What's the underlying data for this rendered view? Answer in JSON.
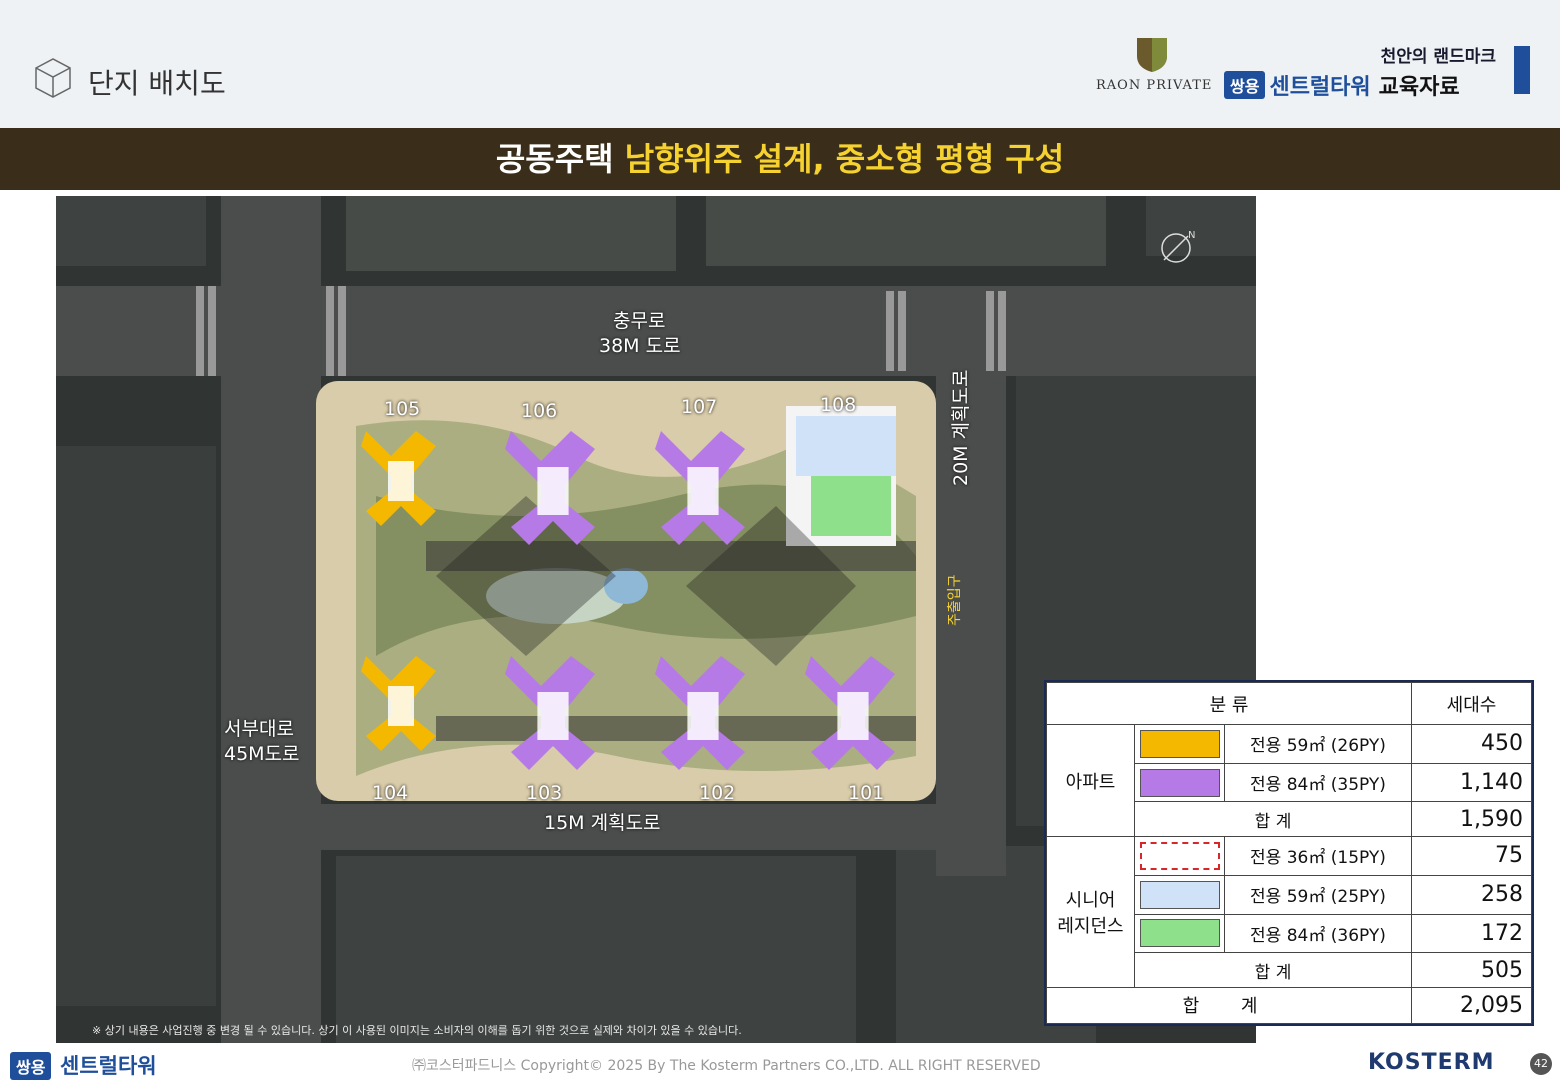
{
  "header": {
    "title": "단지 배치도",
    "raon_text": "RAON PRIVATE",
    "tagline": "천안의 랜드마크",
    "brand_badge": "쌍용",
    "brand_name": "센트럴타워",
    "edu_label": "교육자료"
  },
  "banner": {
    "part1": "공동주택 ",
    "part2": "남향위주 설계, 중소형 평형 구성"
  },
  "plan": {
    "road_north": "충무로",
    "road_north_width": "38M 도로",
    "road_west": "서부대로",
    "road_west_width": "45M도로",
    "road_south": "15M 계획도로",
    "road_east": "20M 계획도로",
    "gate_east": "주출입구",
    "buildings": {
      "b101": "101",
      "b102": "102",
      "b103": "103",
      "b104": "104",
      "b105": "105",
      "b106": "106",
      "b107": "107",
      "b108": "108"
    },
    "disclaimer": "※ 상기 내용은 사업진행 중 변경 될 수 있습니다. 상기 이 사용된 이미지는 소비자의 이해를 돕기 위한 것으로 실제와 차이가 있을 수 있습니다."
  },
  "table": {
    "header_category": "분 류",
    "header_units": "세대수",
    "apt_label": "아파트",
    "senior_label_1": "시니어",
    "senior_label_2": "레지던스",
    "rows": [
      {
        "desc": "전용  59㎡ (26PY)",
        "units": "450"
      },
      {
        "desc": "전용  84㎡ (35PY)",
        "units": "1,140"
      },
      {
        "desc": "합  계",
        "units": "1,590"
      },
      {
        "desc": "전용  36㎡ (15PY)",
        "units": "75"
      },
      {
        "desc": "전용  59㎡ (25PY)",
        "units": "258"
      },
      {
        "desc": "전용  84㎡ (36PY)",
        "units": "172"
      },
      {
        "desc": "합  계",
        "units": "505"
      }
    ],
    "grand_total_label": "합 계",
    "grand_total_units": "2,095"
  },
  "colors": {
    "apt59": "#f5b800",
    "apt84": "#b57ae6",
    "sr59": "#cfe2f7",
    "sr84": "#8ee08a",
    "brand_blue": "#1f4f9b",
    "banner_bg": "#3a2e1b",
    "banner_accent": "#f5d230"
  },
  "footer": {
    "badge": "쌍용",
    "brand": "센트럴타워",
    "copyright": "㈜코스터파드니스 Copyright© 2025 By The Kosterm Partners CO.,LTD. ALL RIGHT RESERVED",
    "kosterm": "KOSTERM",
    "page": "42"
  }
}
